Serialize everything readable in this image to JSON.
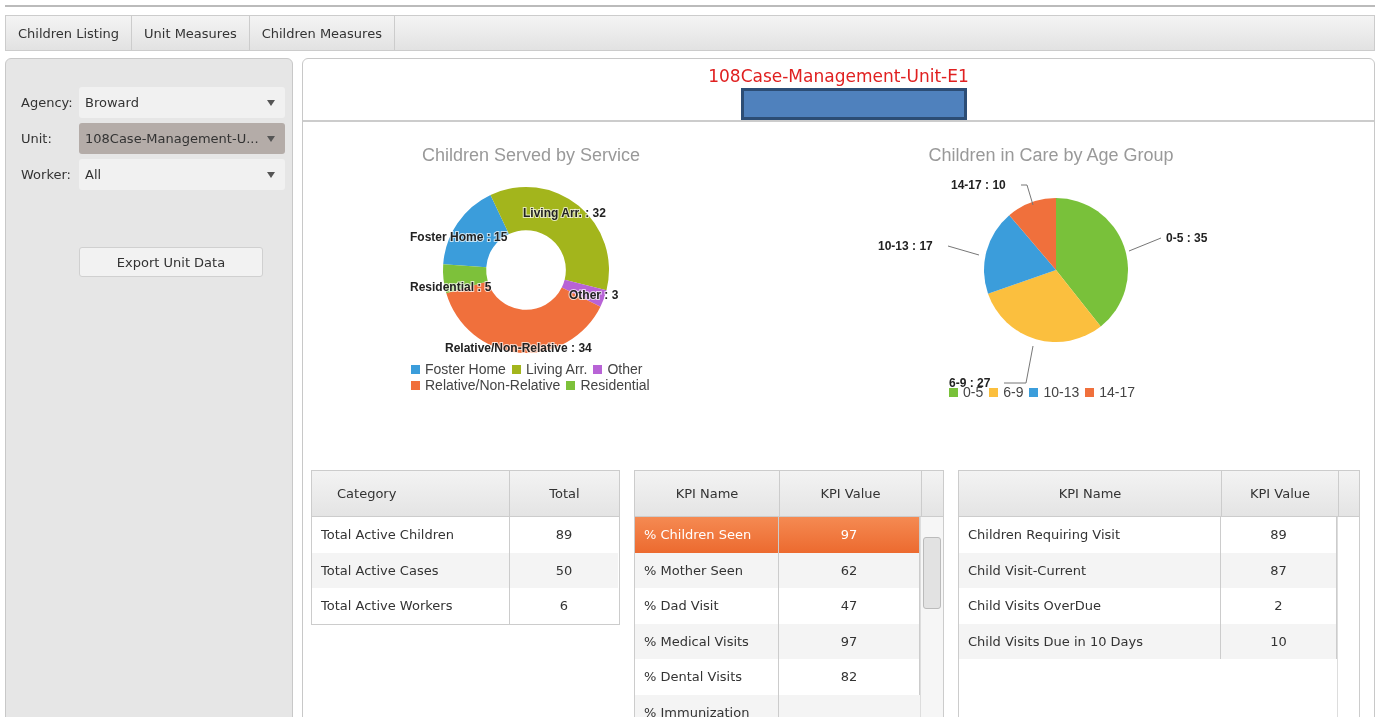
{
  "tabs": [
    {
      "label": "Children Listing",
      "selected": false
    },
    {
      "label": "Unit Measures",
      "selected": false
    },
    {
      "label": "Children Measures",
      "selected": false
    }
  ],
  "filters": [
    {
      "label": "Agency:",
      "value": "Broward",
      "active": false
    },
    {
      "label": "Unit:",
      "value": "108Case-Management-U...",
      "active": true
    },
    {
      "label": "Worker:",
      "value": "All",
      "active": false
    }
  ],
  "export_button": "Export Unit Data",
  "unit_title": "108Case-Management-Unit-E1",
  "charts": [
    {
      "chart_data": {
        "type": "donut",
        "title": "Children Served by Service",
        "categories": [
          "Foster Home",
          "Living Arr.",
          "Other",
          "Relative/Non-Relative",
          "Residential"
        ],
        "values": [
          15,
          32,
          3,
          34,
          5
        ],
        "colors": [
          "#3b9ddb",
          "#a3b51c",
          "#b863d6",
          "#f0703c",
          "#7dc13a"
        ],
        "legend": "bottom",
        "data_labels": true
      },
      "label_separator": " : "
    },
    {
      "chart_data": {
        "type": "pie",
        "title": "Children in Care by Age Group",
        "categories": [
          "0-5",
          "6-9",
          "10-13",
          "14-17"
        ],
        "values": [
          35,
          27,
          17,
          10
        ],
        "colors": [
          "#79c13a",
          "#fbbf3e",
          "#3b9ddb",
          "#f0703c"
        ],
        "legend": "bottom",
        "data_labels": true
      },
      "label_separator": " : "
    }
  ],
  "tables": [
    {
      "columns": [
        "Category",
        "Total"
      ],
      "scroll": false,
      "rows": [
        {
          "cells": [
            "Total Active Children",
            "89"
          ],
          "selected": false
        },
        {
          "cells": [
            "Total Active Cases",
            "50"
          ],
          "selected": false
        },
        {
          "cells": [
            "Total Active Workers",
            "6"
          ],
          "selected": false
        }
      ]
    },
    {
      "columns": [
        "KPI Name",
        "KPI Value"
      ],
      "scroll": true,
      "thumb": true,
      "rows": [
        {
          "cells": [
            "% Children Seen",
            "97"
          ],
          "selected": true
        },
        {
          "cells": [
            "% Mother Seen",
            "62"
          ],
          "selected": false
        },
        {
          "cells": [
            "% Dad Visit",
            "47"
          ],
          "selected": false
        },
        {
          "cells": [
            "% Medical Visits",
            "97"
          ],
          "selected": false
        },
        {
          "cells": [
            "% Dental Visits",
            "82"
          ],
          "selected": false
        },
        {
          "cells": [
            "% Immunization"
          ],
          "selected": false
        }
      ]
    },
    {
      "columns": [
        "KPI Name",
        "KPI Value"
      ],
      "scroll": true,
      "thumb": false,
      "rows": [
        {
          "cells": [
            "Children Requiring Visit",
            "89"
          ],
          "selected": false
        },
        {
          "cells": [
            "Child Visit-Current",
            "87"
          ],
          "selected": false
        },
        {
          "cells": [
            "Child Visits OverDue",
            "2"
          ],
          "selected": false
        },
        {
          "cells": [
            "Child Visits Due in 10 Days",
            "10"
          ],
          "selected": false
        }
      ]
    }
  ]
}
